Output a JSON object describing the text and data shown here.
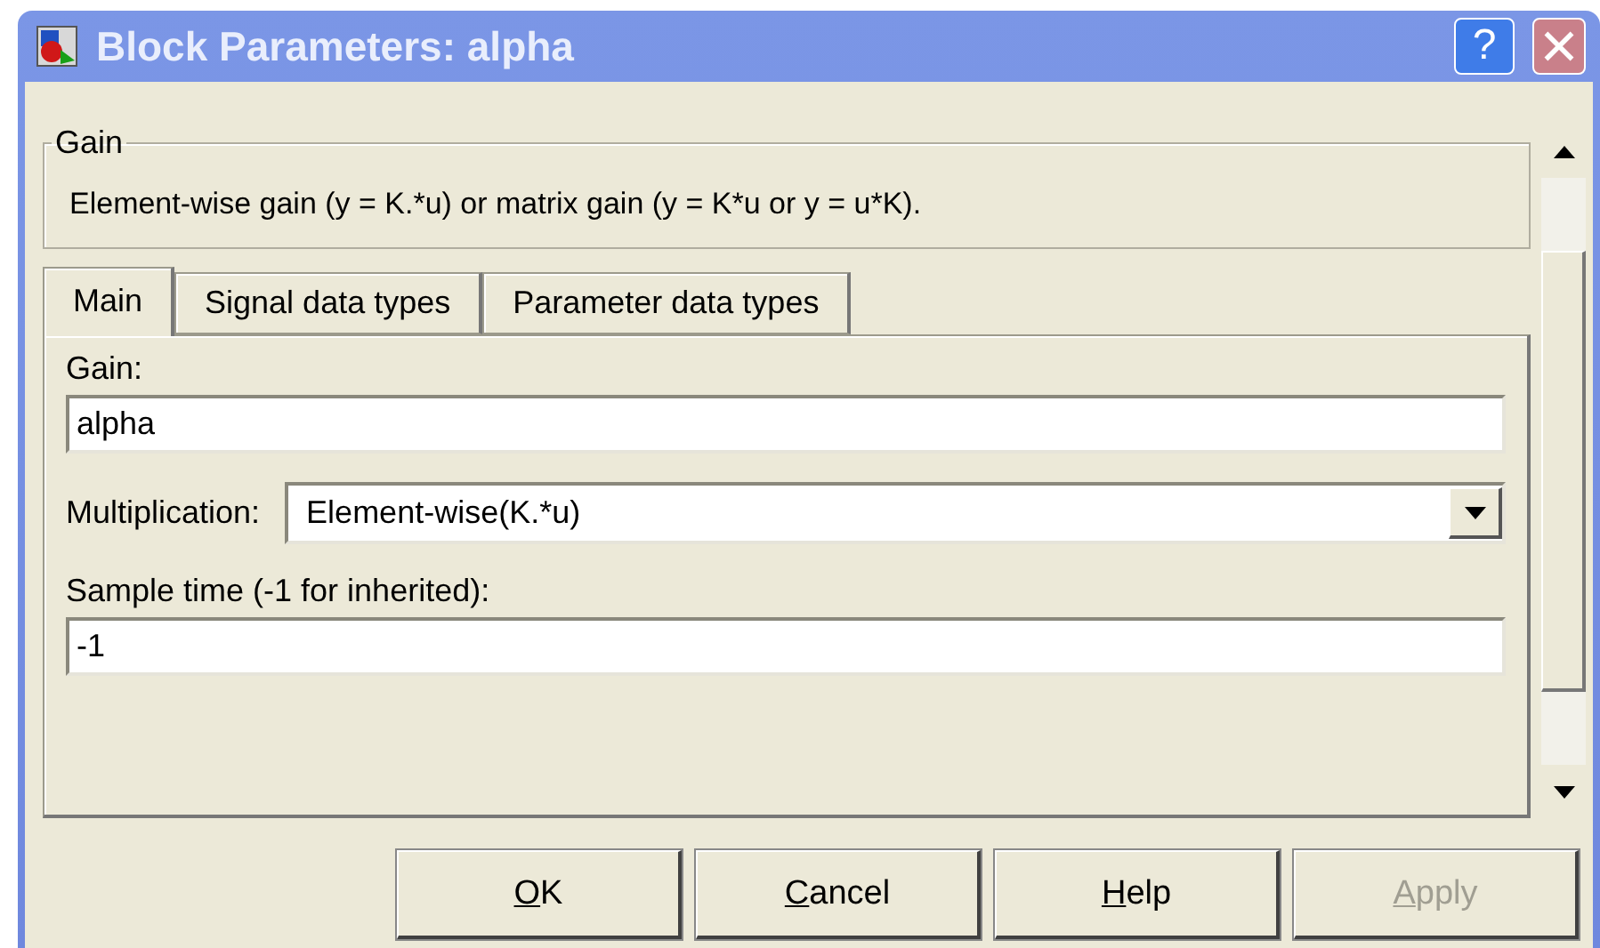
{
  "window": {
    "title": "Block Parameters: alpha",
    "help_glyph": "?"
  },
  "group": {
    "title": "Gain",
    "description": "Element-wise gain (y = K.*u) or matrix gain (y = K*u or y = u*K)."
  },
  "tabs": [
    {
      "label": "Main",
      "selected": true
    },
    {
      "label": "Signal data types",
      "selected": false
    },
    {
      "label": "Parameter data types",
      "selected": false
    }
  ],
  "fields": [
    {
      "kind": "text",
      "label": "Gain:",
      "value": "alpha"
    },
    {
      "kind": "dropdown",
      "label": "Multiplication:",
      "value": "Element-wise(K.*u)"
    },
    {
      "kind": "text",
      "label": "Sample time (-1 for inherited):",
      "value": "-1"
    }
  ],
  "buttons": [
    {
      "label": "OK",
      "mnemonic": true,
      "disabled": false
    },
    {
      "label": "Cancel",
      "mnemonic": true,
      "disabled": false
    },
    {
      "label": "Help",
      "mnemonic": true,
      "disabled": false
    },
    {
      "label": "Apply",
      "mnemonic": true,
      "disabled": true
    }
  ]
}
